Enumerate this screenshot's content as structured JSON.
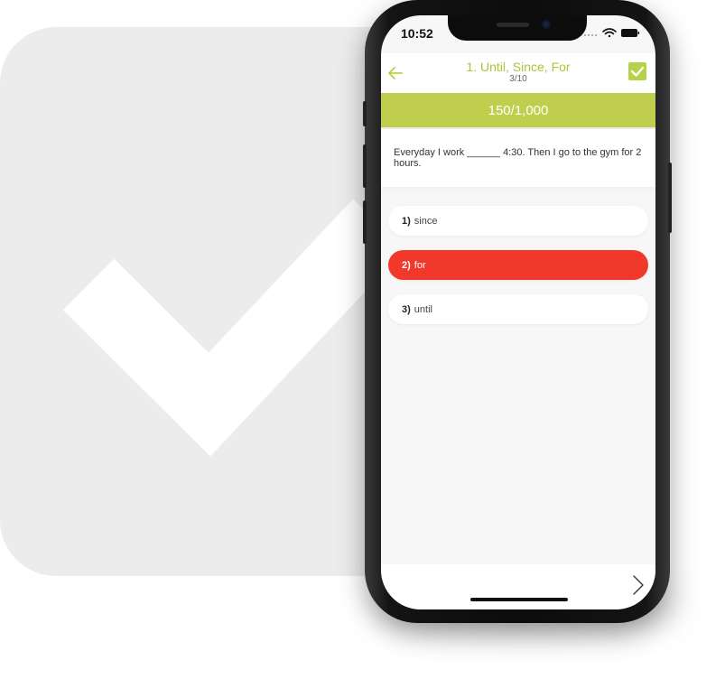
{
  "status_bar": {
    "time": "10:52",
    "icons": [
      "signal-dots-icon",
      "wifi-icon",
      "battery-icon"
    ]
  },
  "header": {
    "back_icon": "arrow-left-icon",
    "title": "1. Until, Since, For",
    "progress": "3/10",
    "check_icon": "checkbox-checked-icon"
  },
  "score": {
    "text": "150/1,000"
  },
  "question": {
    "text": "Everyday I work ______ 4:30. Then I go to the gym for 2 hours."
  },
  "options": [
    {
      "number": "1)",
      "label": "since",
      "selected": false
    },
    {
      "number": "2)",
      "label": "for",
      "selected": true
    },
    {
      "number": "3)",
      "label": "until",
      "selected": false
    }
  ],
  "footer": {
    "next_icon": "chevron-right-icon"
  },
  "colors": {
    "accent_green": "#bfcf4d",
    "title_green": "#a8c63a",
    "selected_red": "#f0392b",
    "background_tile": "#ececec"
  }
}
